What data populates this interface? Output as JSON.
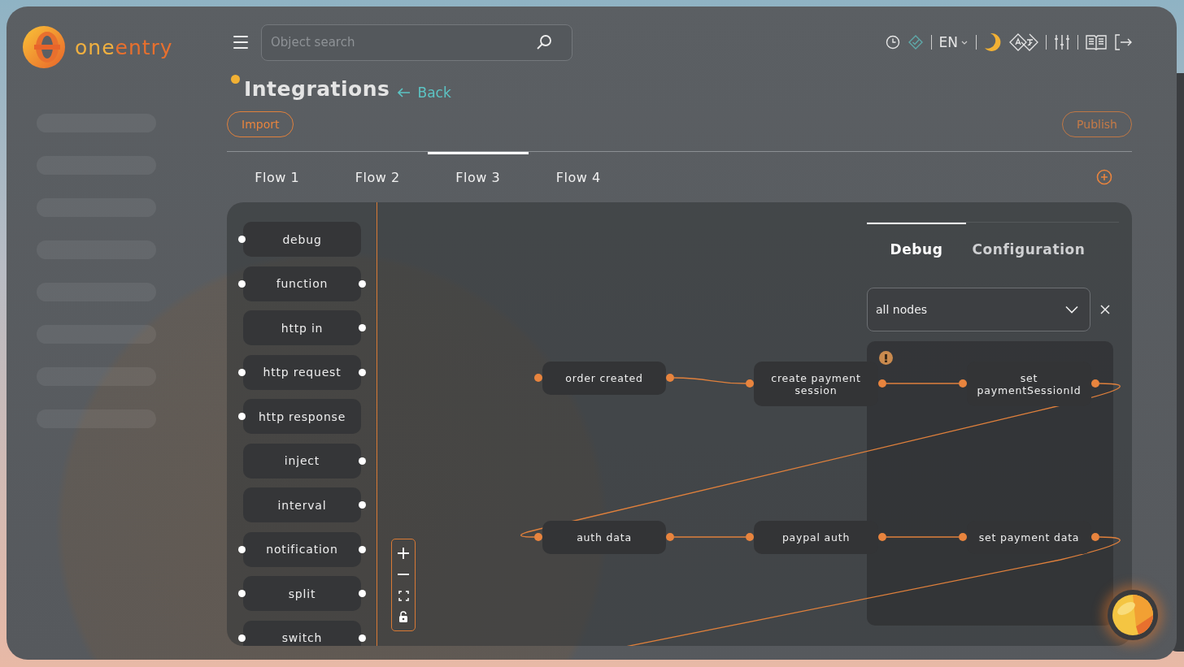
{
  "logo": {
    "part_1": "one",
    "part_2": "entry"
  },
  "search": {
    "placeholder": "Object search"
  },
  "toolbar": {
    "language": "EN"
  },
  "page": {
    "title": "Integrations",
    "back": "Back",
    "unsaved": true
  },
  "actions": {
    "import": "Import",
    "publish": "Publish"
  },
  "tabs": [
    {
      "label": "Flow 1",
      "selected": false
    },
    {
      "label": "Flow 2",
      "selected": false
    },
    {
      "label": "Flow 3",
      "selected": true
    },
    {
      "label": "Flow 4",
      "selected": false
    }
  ],
  "palette": [
    {
      "label": "debug",
      "input": true,
      "output": false
    },
    {
      "label": "function",
      "input": true,
      "output": true
    },
    {
      "label": "http in",
      "input": false,
      "output": true
    },
    {
      "label": "http request",
      "input": true,
      "output": true
    },
    {
      "label": "http response",
      "input": true,
      "output": false
    },
    {
      "label": "inject",
      "input": false,
      "output": true
    },
    {
      "label": "interval",
      "input": false,
      "output": true
    },
    {
      "label": "notification",
      "input": true,
      "output": true
    },
    {
      "label": "split",
      "input": true,
      "output": true
    },
    {
      "label": "switch",
      "input": true,
      "output": true
    }
  ],
  "flow_nodes": [
    {
      "label": "order created",
      "warning": false
    },
    {
      "label": "create payment session",
      "warning": true
    },
    {
      "label": "set paymentSessionId",
      "warning": false
    },
    {
      "label": "auth data",
      "warning": false
    },
    {
      "label": "paypal auth",
      "warning": false
    },
    {
      "label": "set payment data",
      "warning": false
    }
  ],
  "debug_panel": {
    "tabs": [
      {
        "label": "Debug",
        "selected": true
      },
      {
        "label": "Configuration",
        "selected": false
      }
    ],
    "filter": "all nodes"
  }
}
